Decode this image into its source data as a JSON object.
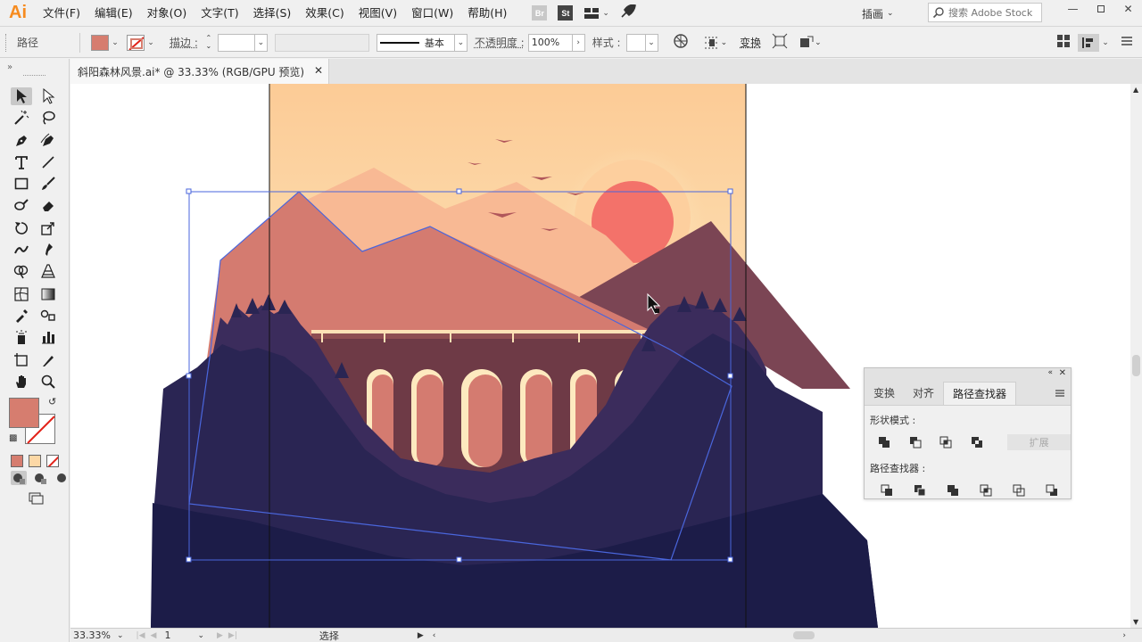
{
  "app": {
    "logo": "Ai"
  },
  "menu": [
    "文件(F)",
    "编辑(E)",
    "对象(O)",
    "文字(T)",
    "选择(S)",
    "效果(C)",
    "视图(V)",
    "窗口(W)",
    "帮助(H)"
  ],
  "menu_icons": {
    "bridge": "Br",
    "stock": "St",
    "layout": "layout-icon",
    "gpu": "rocket-icon"
  },
  "workspace": "插画",
  "stock_search": {
    "placeholder": "搜索 Adobe Stock"
  },
  "window_controls": [
    "minimize-icon",
    "restore-icon",
    "close-icon"
  ],
  "control_bar": {
    "object_type": "路径",
    "fill_color": "#d67d6f",
    "stroke_label": "描边 :",
    "stroke_profile": "基本",
    "opacity_label": "不透明度 :",
    "opacity_value": "100%",
    "style_label": "样式 :",
    "transform_label": "变换"
  },
  "document": {
    "tab_title": "斜阳森林风景.ai* @ 33.33% (RGB/GPU 预览)",
    "zoom": "33.33%",
    "artboard": "1",
    "status_tool": "选择"
  },
  "colors": {
    "sky_top": "#fcd8a6",
    "sun": "#f3726a",
    "mountain_front": "#d47b70",
    "mountain_dark": "#7b4554",
    "forest_dark": "#1c1c48",
    "selection": "#4a66dc"
  },
  "pathfinder_panel": {
    "tabs": [
      "变换",
      "对齐",
      "路径查找器"
    ],
    "active_tab": "路径查找器",
    "shape_modes_label": "形状模式 :",
    "pathfinders_label": "路径查找器 :",
    "expand_label": "扩展"
  }
}
